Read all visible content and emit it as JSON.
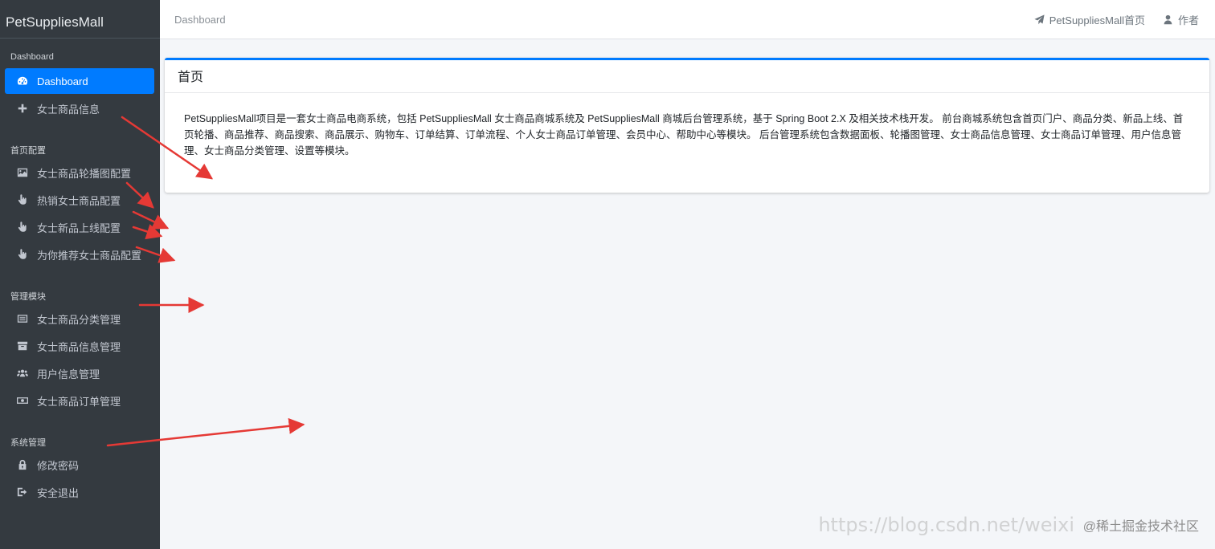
{
  "brand": "PetSuppliesMall",
  "sidebar": {
    "sections": [
      {
        "header": "Dashboard"
      },
      {
        "header": "首页配置"
      },
      {
        "header": "管理模块"
      },
      {
        "header": "系统管理"
      }
    ],
    "items": [
      {
        "label": "Dashboard",
        "icon": "dashboard-icon"
      },
      {
        "label": "女士商品信息",
        "icon": "plus-icon"
      },
      {
        "label": "女士商品轮播图配置",
        "icon": "image-icon"
      },
      {
        "label": "热销女士商品配置",
        "icon": "hand-pointer-icon"
      },
      {
        "label": "女士新品上线配置",
        "icon": "hand-pointer-icon"
      },
      {
        "label": "为你推荐女士商品配置",
        "icon": "hand-pointer-icon"
      },
      {
        "label": "女士商品分类管理",
        "icon": "list-icon"
      },
      {
        "label": "女士商品信息管理",
        "icon": "archive-icon"
      },
      {
        "label": "用户信息管理",
        "icon": "users-icon"
      },
      {
        "label": "女士商品订单管理",
        "icon": "money-icon"
      },
      {
        "label": "修改密码",
        "icon": "lock-icon"
      },
      {
        "label": "安全退出",
        "icon": "sign-out-icon"
      }
    ]
  },
  "topbar": {
    "breadcrumb": "Dashboard",
    "home_link": "PetSuppliesMall首页",
    "author_link": "作者"
  },
  "card": {
    "title": "首页",
    "body": "PetSuppliesMall项目是一套女士商品电商系统，包括 PetSuppliesMall 女士商品商城系统及 PetSuppliesMall 商城后台管理系统，基于 Spring Boot 2.X 及相关技术栈开发。 前台商城系统包含首页门户、商品分类、新品上线、首页轮播、商品推荐、商品搜索、商品展示、购物车、订单结算、订单流程、个人女士商品订单管理、会员中心、帮助中心等模块。 后台管理系统包含数据面板、轮播图管理、女士商品信息管理、女士商品订单管理、用户信息管理、女士商品分类管理、设置等模块。"
  },
  "watermark": {
    "url": "https://blog.csdn.net/weixi",
    "label": "@稀土掘金技术社区"
  },
  "colors": {
    "sidebar_bg": "#343a40",
    "accent": "#007bff",
    "annotation_arrow": "#e53935"
  }
}
